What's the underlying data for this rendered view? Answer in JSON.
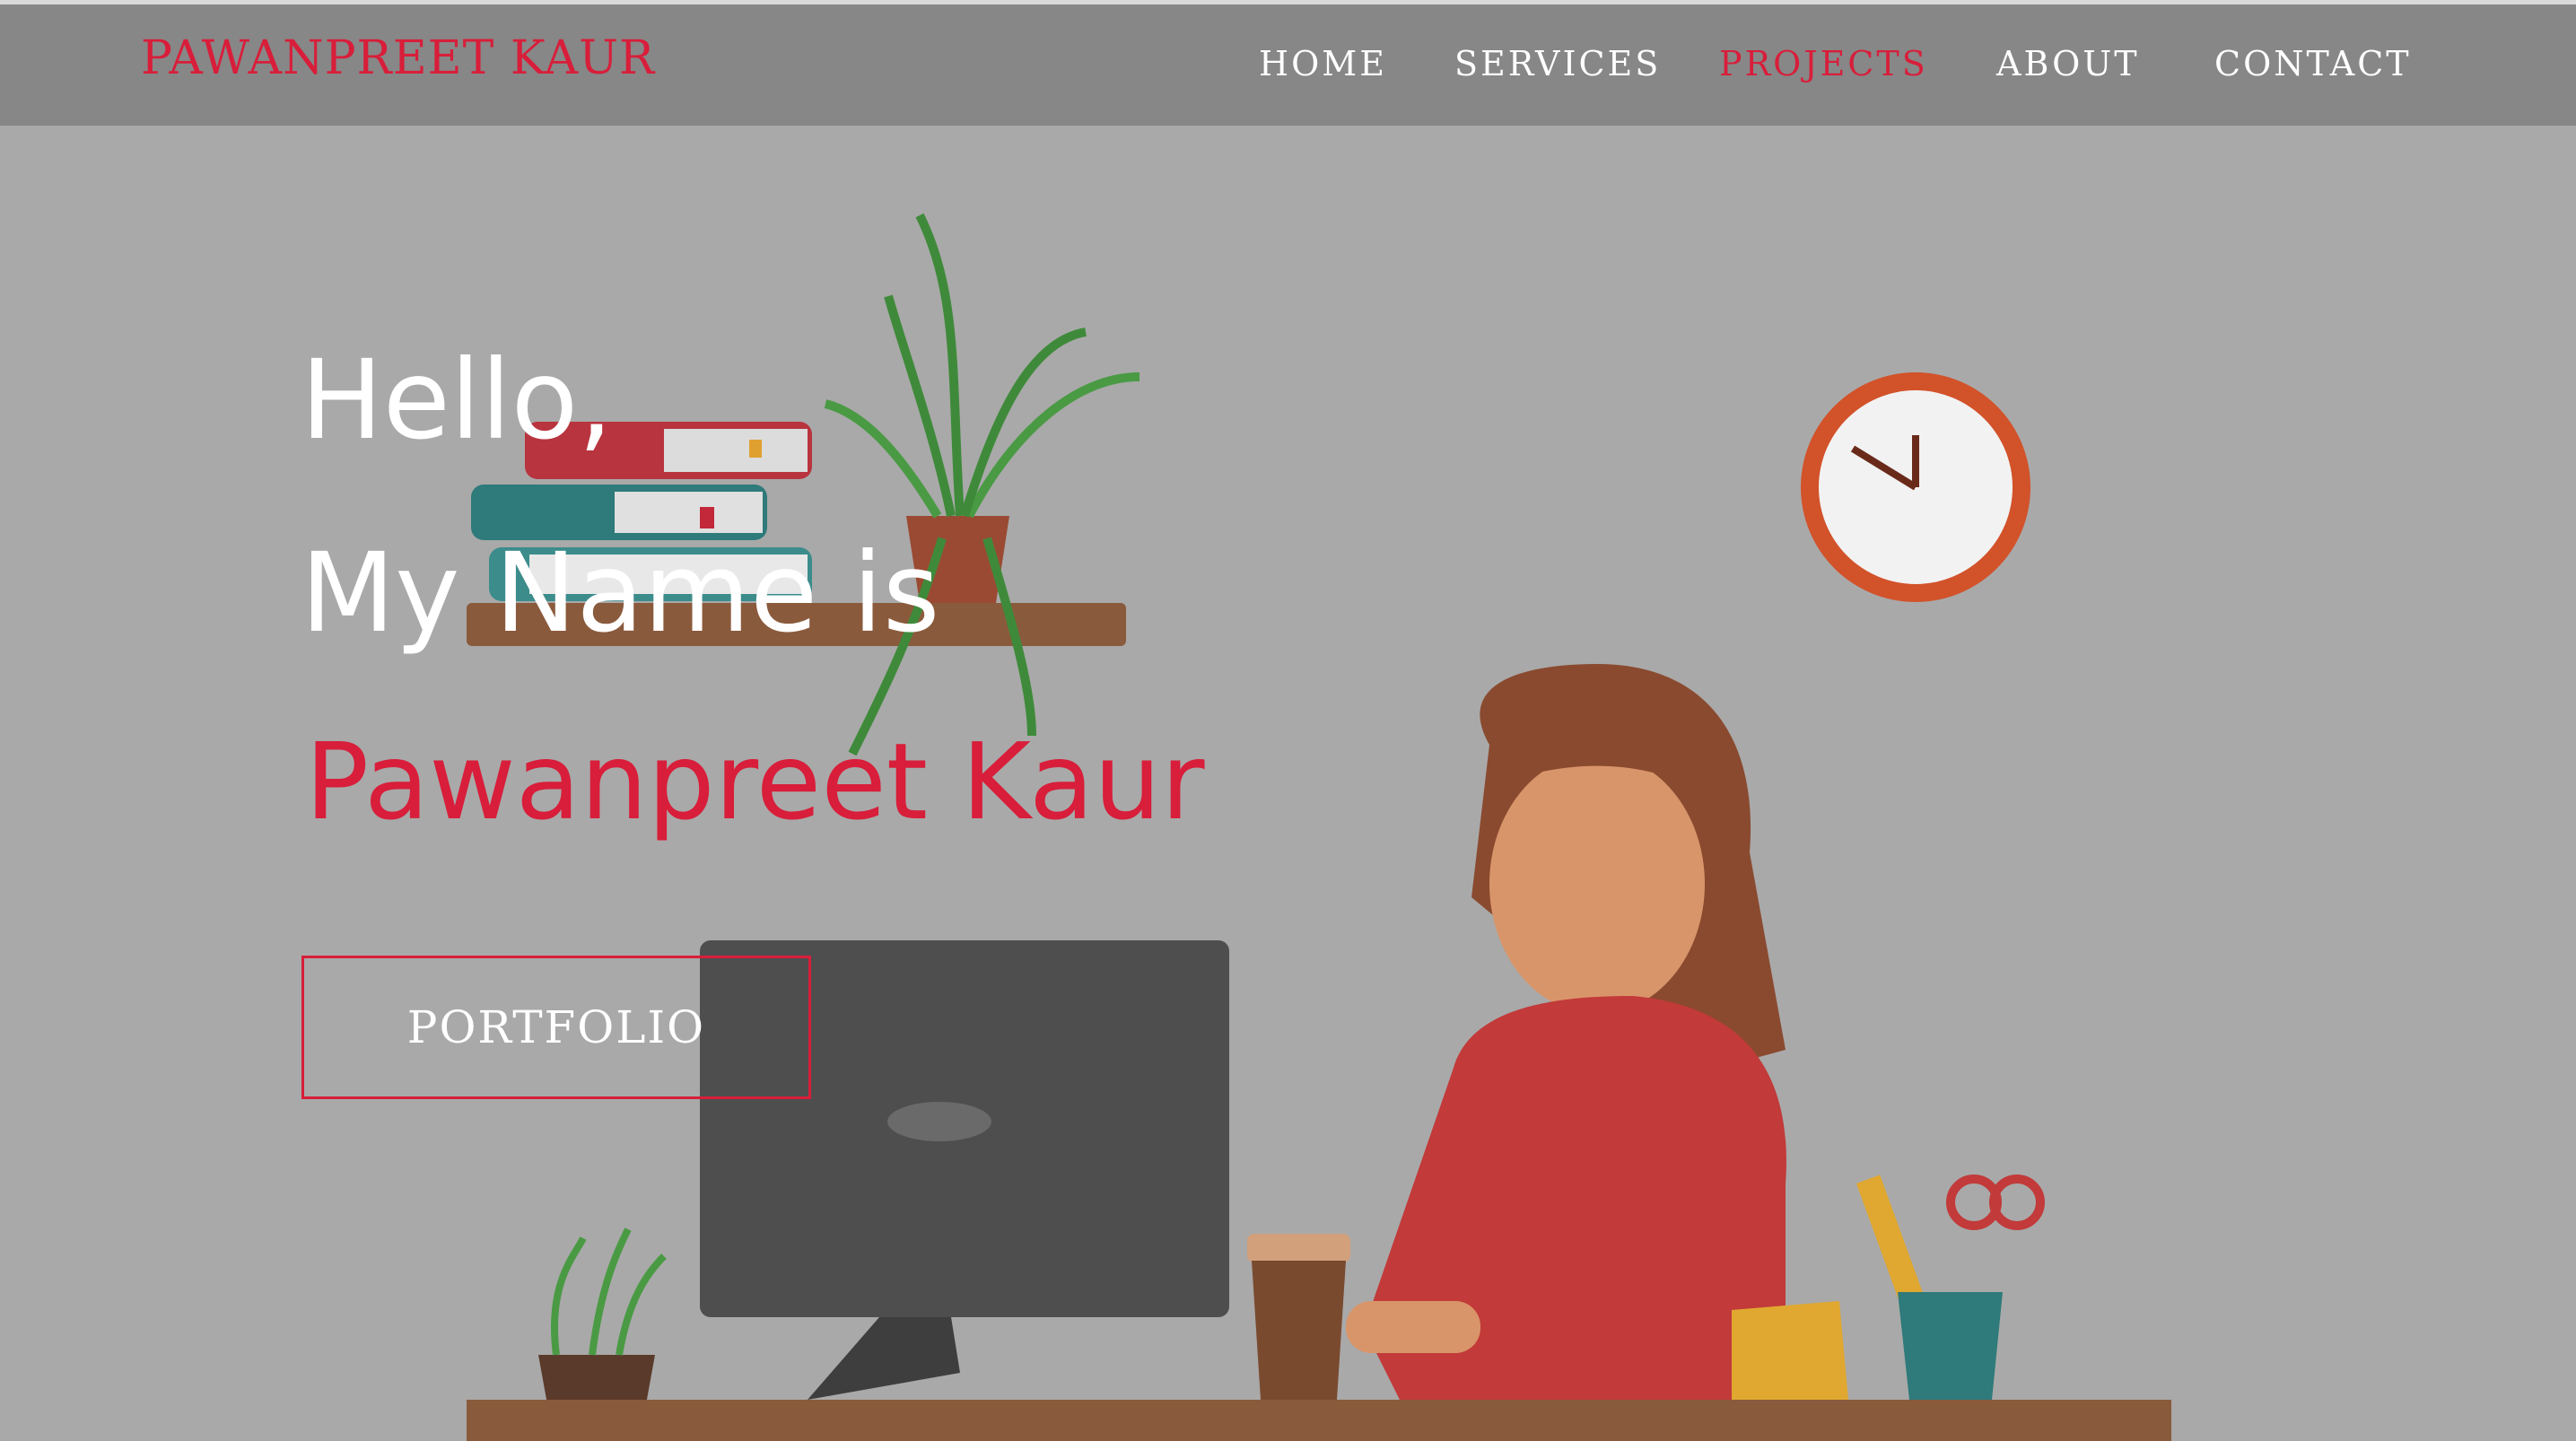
{
  "header": {
    "brand": "PAWANPREET KAUR",
    "nav": [
      {
        "label": "HOME",
        "active": false
      },
      {
        "label": "SERVICES",
        "active": false
      },
      {
        "label": "PROJECTS",
        "active": true
      },
      {
        "label": "ABOUT",
        "active": false
      },
      {
        "label": "CONTACT",
        "active": false
      }
    ]
  },
  "hero": {
    "line1": "Hello,",
    "line2": "My Name is",
    "name": "Pawanpreet Kaur",
    "cta_label": "PORTFOLIO"
  },
  "colors": {
    "accent": "#d81e3a",
    "background": "#a9a9a9",
    "navbar": "#878787"
  }
}
